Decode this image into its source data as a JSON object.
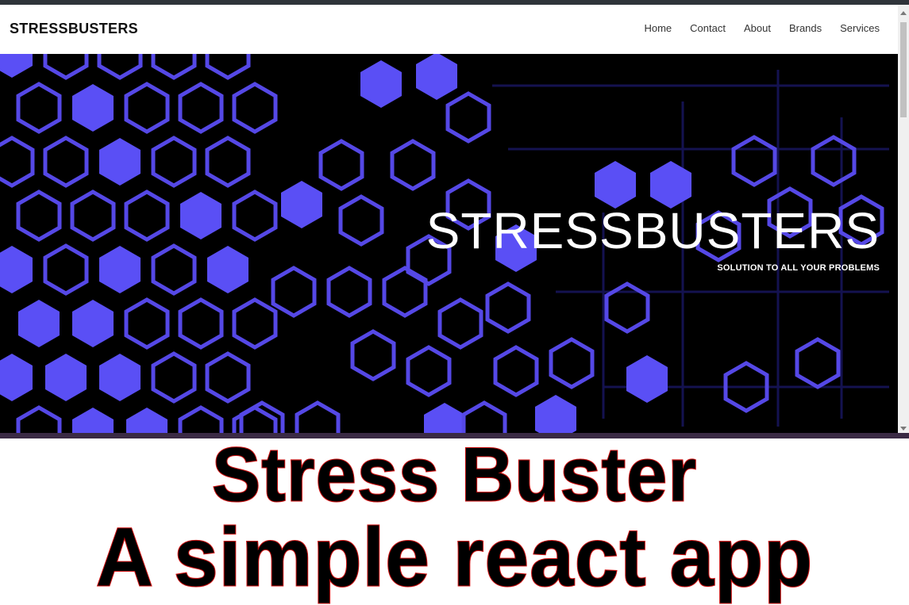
{
  "navbar": {
    "brand": "STRESSBUSTERS",
    "links": [
      "Home",
      "Contact",
      "About",
      "Brands",
      "Services"
    ]
  },
  "hero": {
    "title": "STRESSBUSTERS",
    "subtitle": "SOLUTION TO ALL YOUR PROBLEMS"
  },
  "caption": {
    "line1": "Stress Buster",
    "line2": "A simple react app"
  },
  "colors": {
    "hex_fill": "#5a4ff5",
    "hex_stroke": "#5548e6",
    "hero_background": "#000000",
    "caption_stroke": "#d01010"
  }
}
